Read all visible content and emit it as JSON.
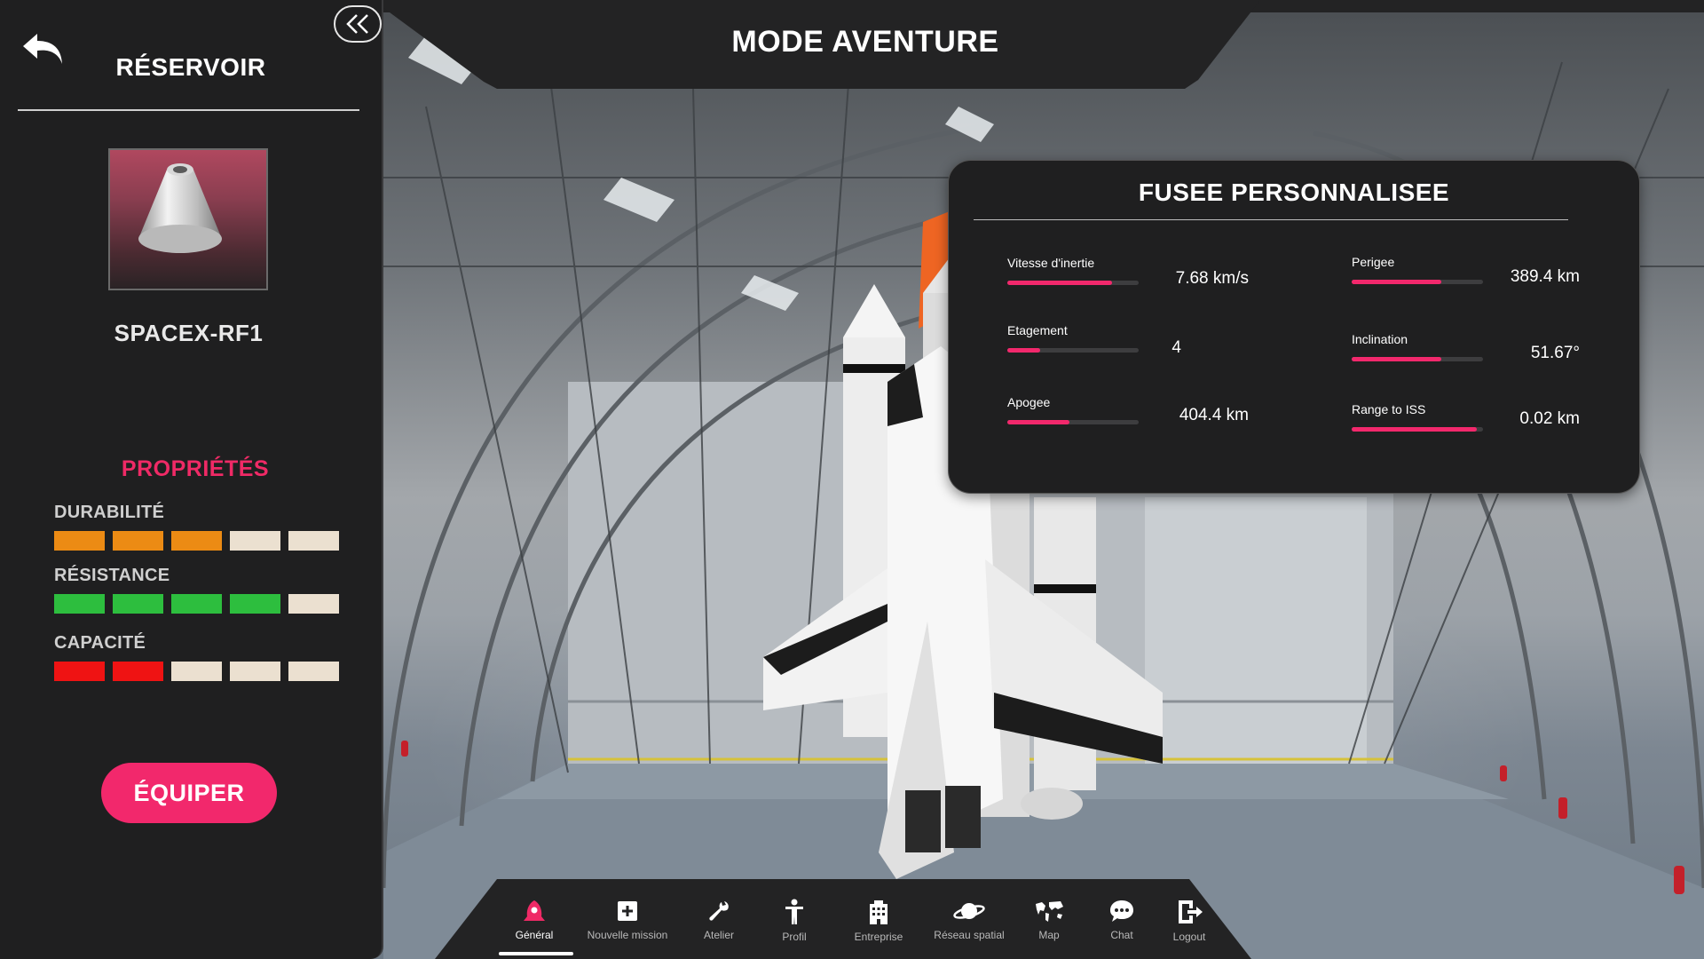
{
  "header": {
    "title": "MODE AVENTURE"
  },
  "left_panel": {
    "title": "RÉSERVOIR",
    "back_icon": "back-arrow-icon",
    "collapse_icon": "double-chevron-left-icon",
    "item": {
      "name": "SPACEX-RF1",
      "thumbnail": "fuel-tank-cone"
    },
    "properties_title": "PROPRIÉTÉS",
    "stats": [
      {
        "label": "DURABILITÉ",
        "value": 3,
        "max": 5,
        "color": "#ec8b14"
      },
      {
        "label": "RÉSISTANCE",
        "value": 4,
        "max": 5,
        "color": "#2dbe3e"
      },
      {
        "label": "CAPACITÉ",
        "value": 2,
        "max": 5,
        "color": "#ef1313"
      }
    ],
    "empty_color": "#ebe0d0",
    "equip_label": "ÉQUIPER"
  },
  "rocket_card": {
    "title": "FUSEE PERSONNALISEE",
    "accent": "#f2286c",
    "metrics": [
      {
        "label": "Vitesse d'inertie",
        "value": "7.68 km/s",
        "level": 0.8
      },
      {
        "label": "Perigee",
        "value": "389.4 km",
        "level": 0.68
      },
      {
        "label": "Etagement",
        "value": "4",
        "level": 0.25
      },
      {
        "label": "Inclination",
        "value": "51.67°",
        "level": 0.68
      },
      {
        "label": "Apogee",
        "value": "404.4 km",
        "level": 0.47
      },
      {
        "label": "Range to ISS",
        "value": "0.02 km",
        "level": 0.95
      }
    ]
  },
  "nav": {
    "items": [
      {
        "label": "Général",
        "icon": "rocket-icon",
        "active": true
      },
      {
        "label": "Nouvelle mission",
        "icon": "plus-box-icon",
        "active": false
      },
      {
        "label": "Atelier",
        "icon": "wrench-icon",
        "active": false
      },
      {
        "label": "Profil",
        "icon": "person-icon",
        "active": false
      },
      {
        "label": "Entreprise",
        "icon": "building-icon",
        "active": false
      },
      {
        "label": "Réseau spatial",
        "icon": "planet-icon",
        "active": false
      },
      {
        "label": "Map",
        "icon": "world-map-icon",
        "active": false
      },
      {
        "label": "Chat",
        "icon": "chat-bubble-icon",
        "active": false
      },
      {
        "label": "Logout",
        "icon": "logout-icon",
        "active": false
      }
    ]
  }
}
